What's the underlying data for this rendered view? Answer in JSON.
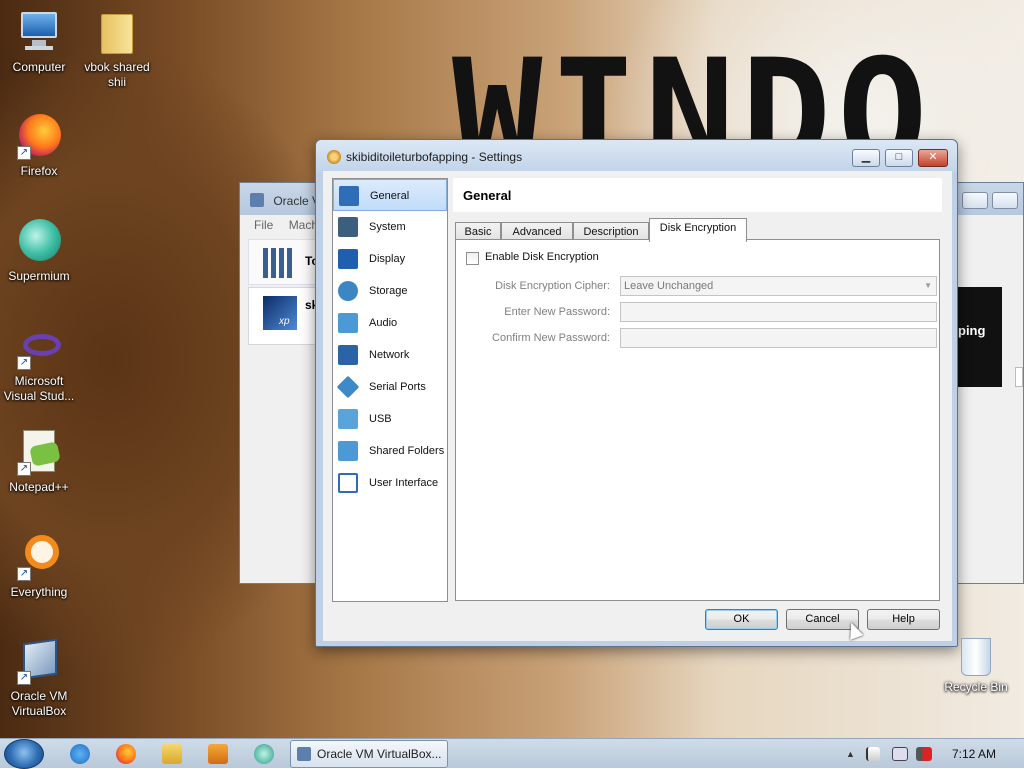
{
  "desktop": {
    "wallpaper_text": "WINDO",
    "icons": [
      {
        "label": "Computer",
        "icon": "computer-icon"
      },
      {
        "label": "vbok shared shii",
        "icon": "folder-icon"
      },
      {
        "label": "Firefox",
        "icon": "firefox-icon"
      },
      {
        "label": "Supermium",
        "icon": "supermium-icon"
      },
      {
        "label": "Microsoft Visual Stud...",
        "icon": "visual-studio-icon"
      },
      {
        "label": "Notepad++",
        "icon": "notepadpp-icon"
      },
      {
        "label": "Everything",
        "icon": "everything-icon"
      },
      {
        "label": "Oracle VM VirtualBox",
        "icon": "virtualbox-icon"
      },
      {
        "label": "Recycle Bin",
        "icon": "recycle-bin-icon"
      }
    ]
  },
  "vbox_main": {
    "title": "Oracle VM",
    "menu_file": "File",
    "menu_machine": "Machi",
    "tools_label": "To",
    "vm_name": "sk",
    "vm_badge": "xp",
    "preview_text": "ping"
  },
  "settings": {
    "title": "skibiditoileturbofapping - Settings",
    "sidebar": [
      {
        "label": "General",
        "icon": "general-icon",
        "color": "#2f6db8"
      },
      {
        "label": "System",
        "icon": "system-icon",
        "color": "#3b5f7d"
      },
      {
        "label": "Display",
        "icon": "display-icon",
        "color": "#1f5fb0"
      },
      {
        "label": "Storage",
        "icon": "storage-icon",
        "color": "#3c86c4"
      },
      {
        "label": "Audio",
        "icon": "audio-icon",
        "color": "#4a9ad8"
      },
      {
        "label": "Network",
        "icon": "network-icon",
        "color": "#2a63a8"
      },
      {
        "label": "Serial Ports",
        "icon": "serial-ports-icon",
        "color": "#3e89c8"
      },
      {
        "label": "USB",
        "icon": "usb-icon",
        "color": "#5aa4dc"
      },
      {
        "label": "Shared Folders",
        "icon": "shared-folders-icon",
        "color": "#4b9ad6"
      },
      {
        "label": "User Interface",
        "icon": "user-interface-icon",
        "color": "#2f6db8"
      }
    ],
    "selected_section": "General",
    "page_header": "General",
    "tabs": [
      "Basic",
      "Advanced",
      "Description",
      "Disk Encryption"
    ],
    "active_tab": "Disk Encryption",
    "enable_checkbox": {
      "label": "Enable Disk Encryption",
      "checked": false
    },
    "cipher": {
      "label": "Disk Encryption Cipher:",
      "value": "Leave Unchanged"
    },
    "new_password": {
      "label": "Enter New Password:",
      "value": ""
    },
    "confirm_password": {
      "label": "Confirm New Password:",
      "value": ""
    },
    "buttons": {
      "ok": "OK",
      "cancel": "Cancel",
      "help": "Help"
    }
  },
  "taskbar": {
    "task_label": "Oracle VM VirtualBox...",
    "clock": "7:12 AM",
    "tray_arrow": "▲"
  }
}
